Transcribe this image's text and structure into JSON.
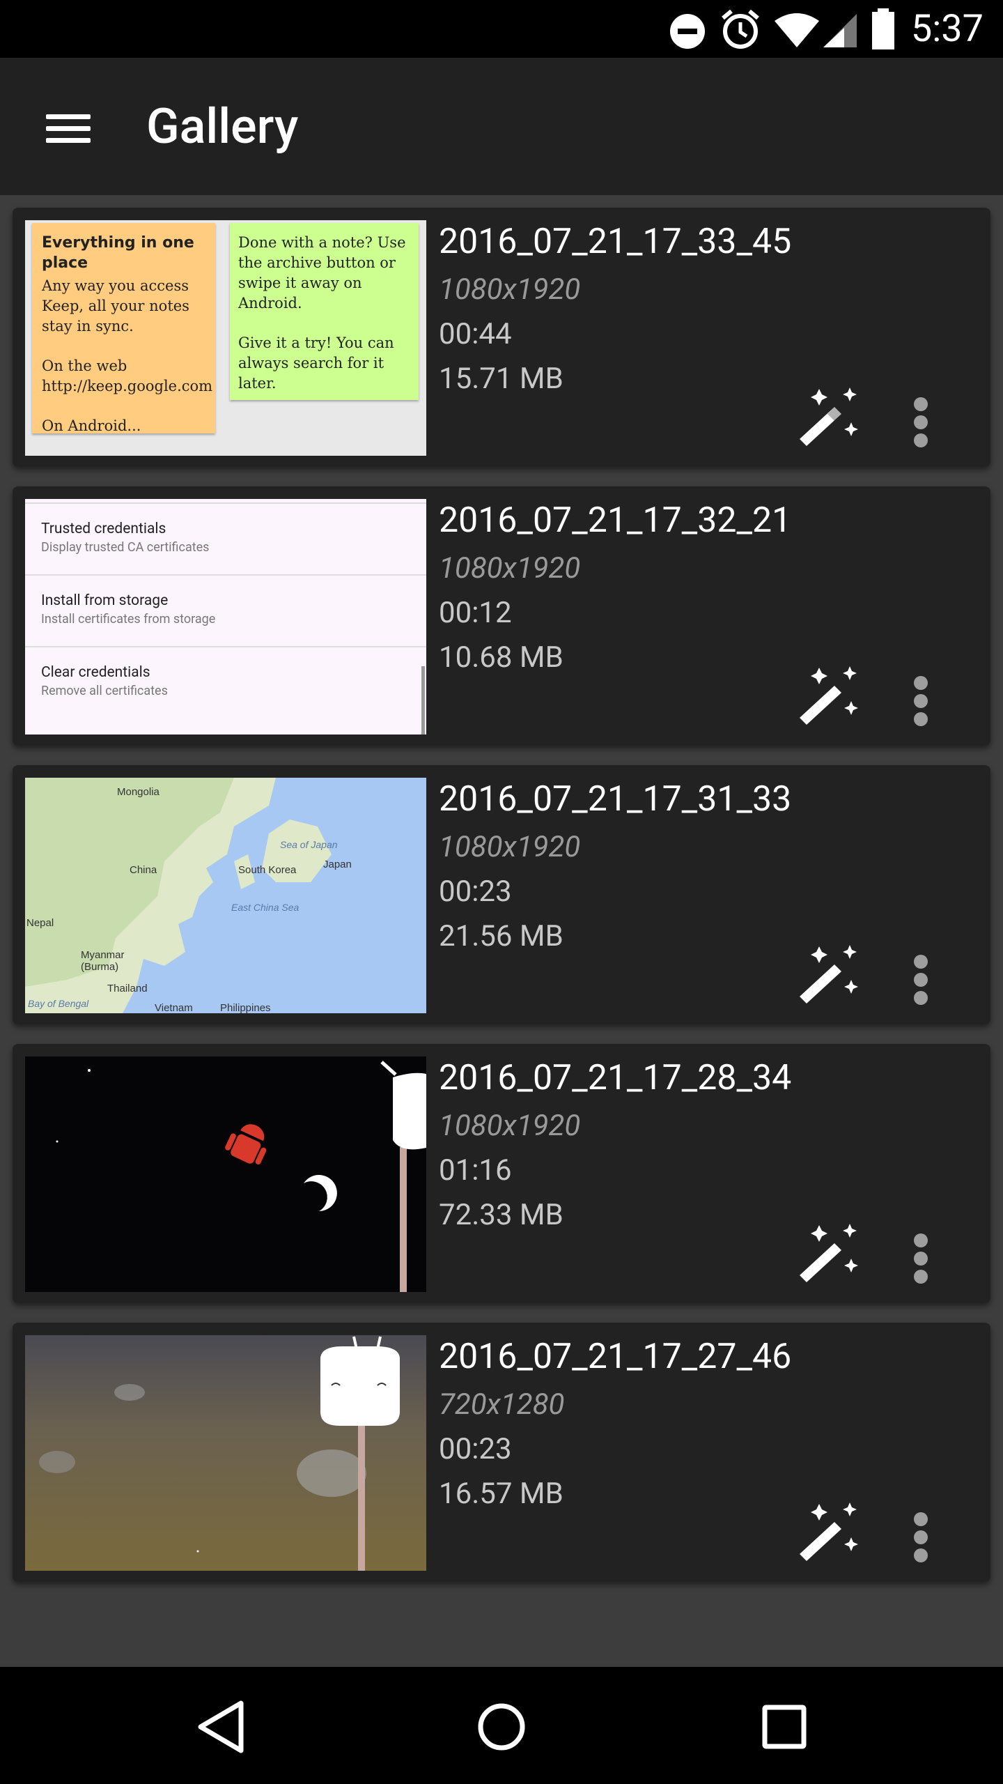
{
  "status_bar": {
    "time": "5:37"
  },
  "app_bar": {
    "title": "Gallery"
  },
  "items": [
    {
      "name": "2016_07_21_17_33_45",
      "resolution": "1080x1920",
      "duration": "00:44",
      "size": "15.71 MB"
    },
    {
      "name": "2016_07_21_17_32_21",
      "resolution": "1080x1920",
      "duration": "00:12",
      "size": "10.68 MB"
    },
    {
      "name": "2016_07_21_17_31_33",
      "resolution": "1080x1920",
      "duration": "00:23",
      "size": "21.56 MB"
    },
    {
      "name": "2016_07_21_17_28_34",
      "resolution": "1080x1920",
      "duration": "01:16",
      "size": "72.33 MB"
    },
    {
      "name": "2016_07_21_17_27_46",
      "resolution": "720x1280",
      "duration": "00:23",
      "size": "16.57 MB"
    }
  ],
  "thumb_keep": {
    "note1_title": "Everything in one place",
    "note1_p1": "Any way you access Keep, all your notes stay in sync.",
    "note1_p2": "On the web http://keep.google.com",
    "note1_p3": "On Android...",
    "note2_p1": "Done with a note? Use the archive button or swipe it away on Android.",
    "note2_p2": "Give it a try! You can always search for it later."
  },
  "thumb_settings": {
    "rows": [
      {
        "title": "Trusted credentials",
        "sub": "Display trusted CA certificates"
      },
      {
        "title": "Install from storage",
        "sub": "Install certificates from storage"
      },
      {
        "title": "Clear credentials",
        "sub": "Remove all certificates"
      }
    ]
  },
  "thumb_map": {
    "labels": [
      "Mongolia",
      "China",
      "South Korea",
      "Japan",
      "Sea of Japan",
      "East China Sea",
      "Nepal",
      "Myanmar (Burma)",
      "Thailand",
      "Bay of Bengal",
      "Vietnam",
      "Philippines"
    ]
  },
  "icons": {
    "menu": "hamburger-icon",
    "edit": "magic-wand-icon",
    "more": "more-vert-icon",
    "back": "back-triangle-icon",
    "home": "home-circle-icon",
    "recents": "recents-square-icon"
  },
  "colors": {
    "status_bar": "#000000",
    "app_bar": "#212121",
    "card": "#222222",
    "background": "#3d3d3d"
  }
}
